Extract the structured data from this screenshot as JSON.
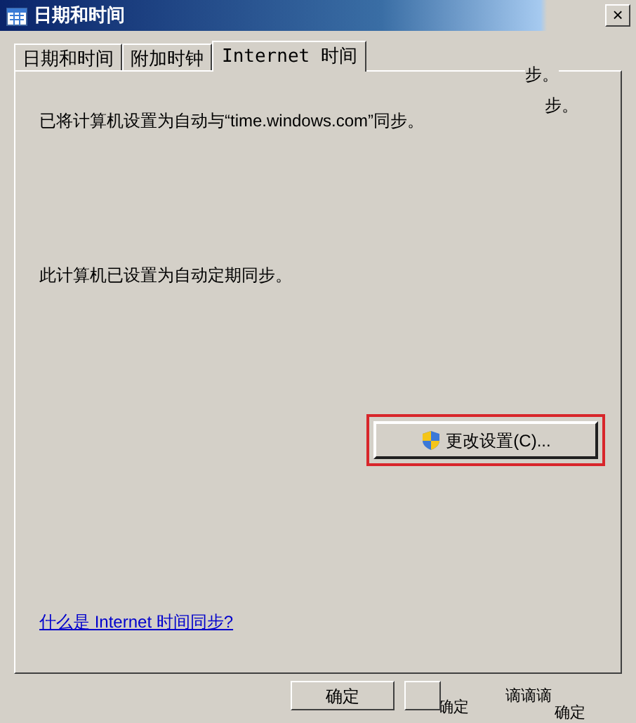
{
  "window": {
    "title": "日期和时间",
    "close": "×"
  },
  "tabs": [
    {
      "label": "日期和时间",
      "selected": false
    },
    {
      "label": "附加时钟",
      "selected": false
    },
    {
      "label": "Internet 时间",
      "selected": true
    }
  ],
  "panel": {
    "status": "已将计算机设置为自动与“time.windows.com”同步。",
    "schedule": "此计算机已设置为自动定期同步。",
    "change_button": {
      "label": "更改设置(C)...",
      "highlighted": true
    },
    "link": "什么是 Internet 时间同步?"
  },
  "stray_texts": [
    {
      "text": "步。"
    },
    {
      "text": "步。"
    },
    {
      "text": "确定"
    },
    {
      "text": "谪谪谪"
    },
    {
      "text": "确定"
    }
  ],
  "buttons": [
    {
      "kind": "labeled",
      "label": "确定"
    },
    {
      "kind": "blank"
    }
  ]
}
